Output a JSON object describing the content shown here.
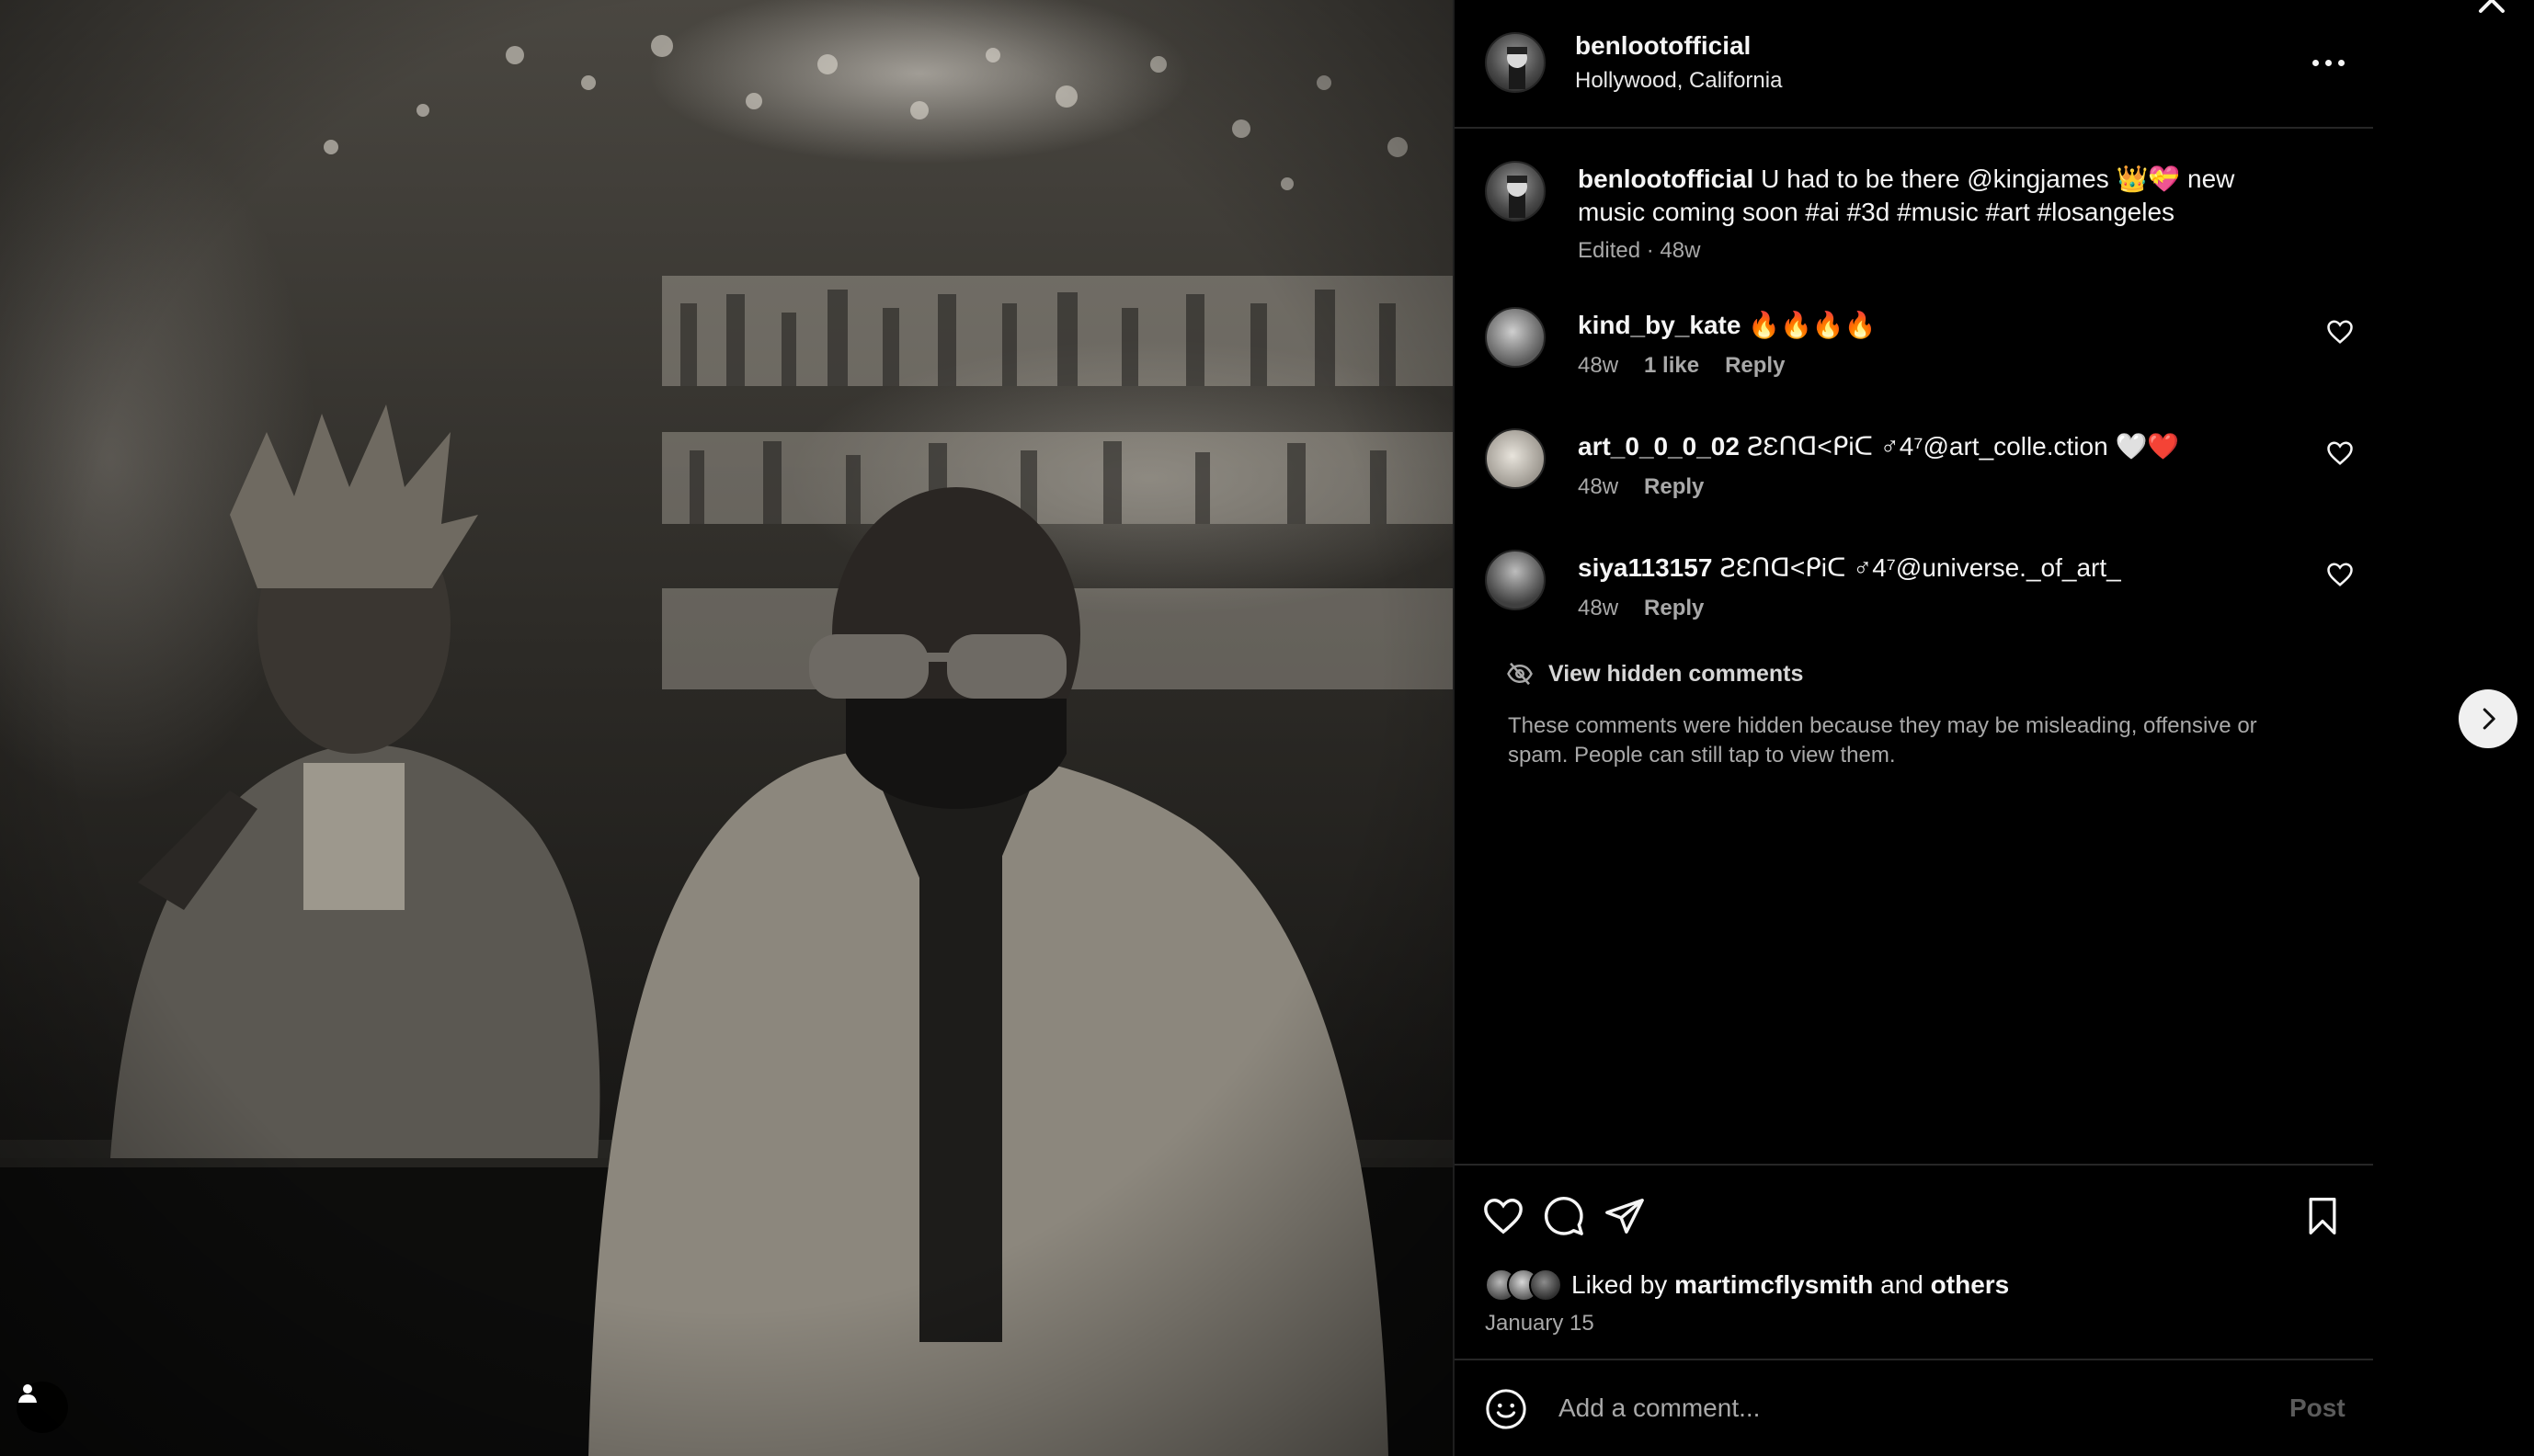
{
  "post": {
    "username": "benlootofficial",
    "location": "Hollywood, California",
    "caption": {
      "username": "benlootofficial",
      "text": "U had to be there @kingjames 👑💝 new music coming soon #ai #3d #music #art #losangeles",
      "meta": "Edited · 48w"
    }
  },
  "comments": [
    {
      "username": "kind_by_kate",
      "text": "🔥🔥🔥🔥",
      "age": "48w",
      "likes": "1 like",
      "reply": "Reply"
    },
    {
      "username": "art_0_0_0_02",
      "text": "ꙄƐՈᗡ<ᑭiᑕ ♂4⁷@art_colle.ction 🤍❤️",
      "age": "48w",
      "reply": "Reply"
    },
    {
      "username": "siya113157",
      "text": "ꙄƐՈᗡ<ᑭiᑕ ♂4⁷@universe._of_art_",
      "age": "48w",
      "reply": "Reply"
    }
  ],
  "hidden": {
    "link": "View hidden comments",
    "note": "These comments were hidden because they may be misleading, offensive or spam. People can still tap to view them."
  },
  "likes": {
    "prefix": "Liked by",
    "user": "martimcflysmith",
    "joiner": "and",
    "others": "others"
  },
  "date": "January 15",
  "composer": {
    "placeholder": "Add a comment...",
    "post_label": "Post"
  },
  "icons": {
    "more": "more-horizontal-icon",
    "heart": "heart-icon",
    "comment": "comment-icon",
    "share": "share-icon",
    "bookmark": "bookmark-icon",
    "emoji": "emoji-icon",
    "close": "close-icon",
    "next": "chevron-right-icon",
    "hidden": "eye-off-icon",
    "user": "user-icon"
  },
  "colors": {
    "background": "#000000",
    "text": "#f5f5f5",
    "secondary_text": "#a8a8a8",
    "divider": "#262626",
    "post_disabled": "#5b5b5b"
  }
}
